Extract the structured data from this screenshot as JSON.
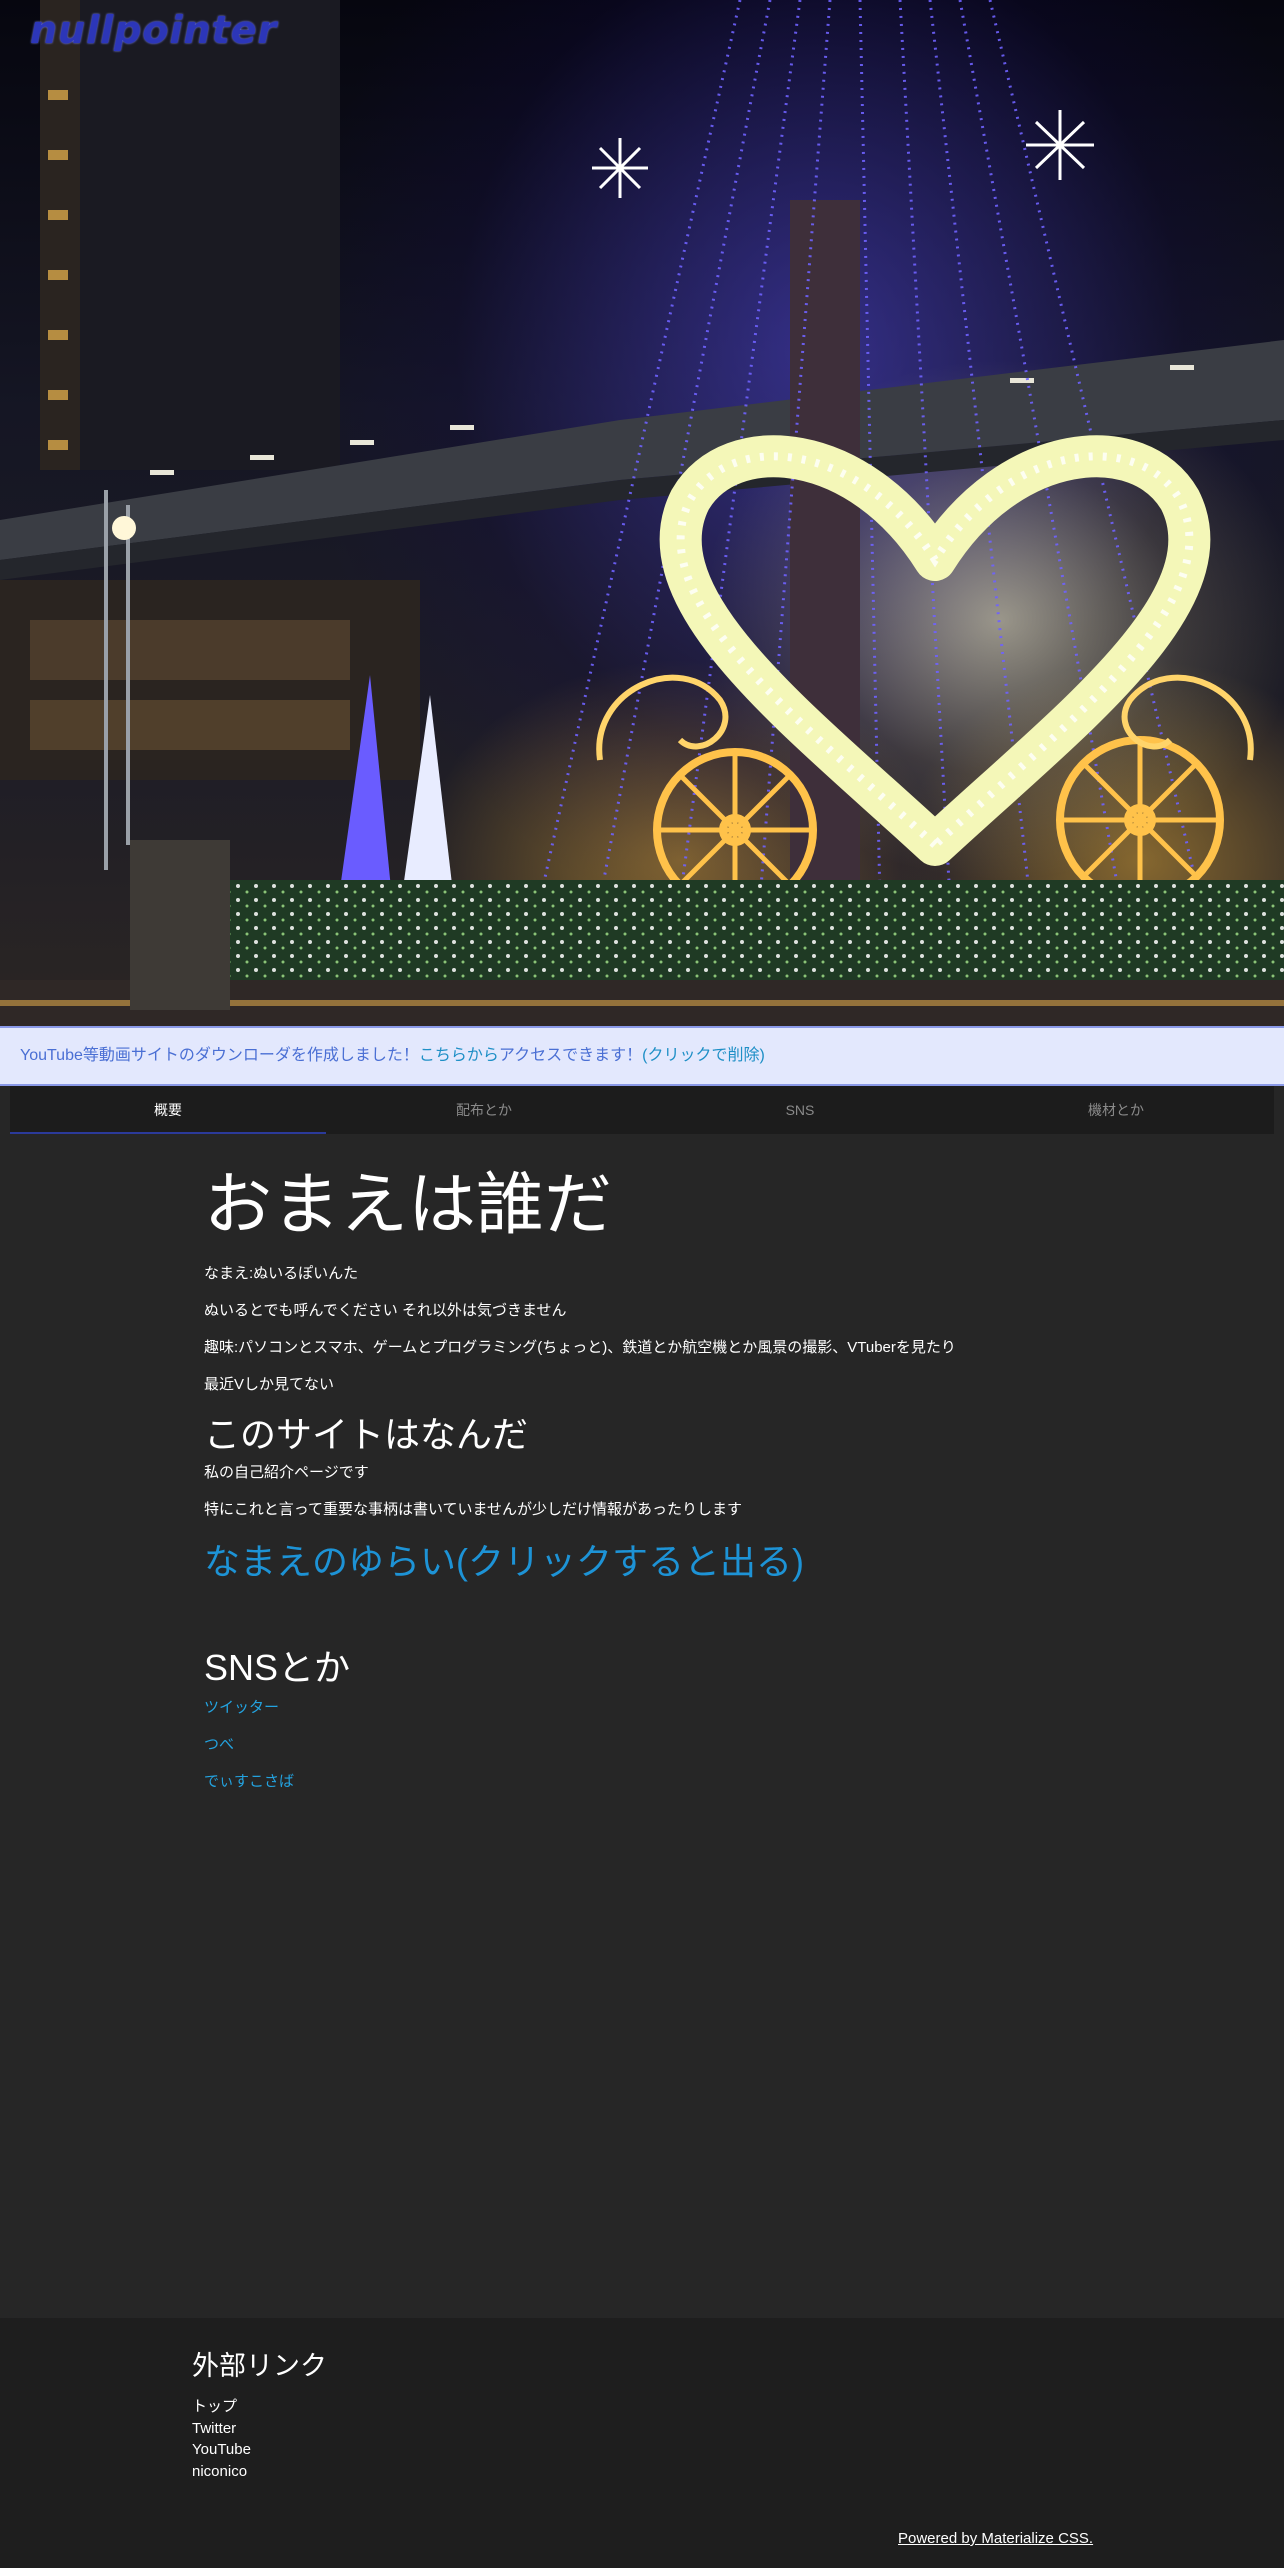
{
  "header": {
    "logo_text": "nullpointer"
  },
  "banner": {
    "text_before": "YouTube等動画サイトのダウンローダを作成しました！",
    "link_text": "こちらから",
    "text_after": "アクセスできます！",
    "dismiss_text": "(クリックで削除)"
  },
  "tabs": [
    {
      "label": "概要",
      "active": true
    },
    {
      "label": "配布とか",
      "active": false
    },
    {
      "label": "SNS",
      "active": false
    },
    {
      "label": "機材とか",
      "active": false
    }
  ],
  "about": {
    "title": "おまえは誰だ",
    "lines": [
      "なまえ:ぬいるぽいんた",
      "ぬいるとでも呼んでください それ以外は気づきません",
      "趣味:パソコンとスマホ、ゲームとプログラミング(ちょっと)、鉄道とか航空機とか風景の撮影、VTuberを見たり",
      "最近Vしか見てない"
    ]
  },
  "site": {
    "title": "このサイトはなんだ",
    "lines": [
      "私の自己紹介ページです",
      "特にこれと言って重要な事柄は書いていませんが少しだけ情報があったりします"
    ],
    "origin_link": "なまえのゆらい(クリックすると出る)"
  },
  "sns": {
    "title": "SNSとか",
    "links": [
      "ツイッター",
      "つべ",
      "でぃすこさば"
    ]
  },
  "footer": {
    "title": "外部リンク",
    "links": [
      "トップ",
      "Twitter",
      "YouTube",
      "niconico"
    ],
    "powered": "Powered by Materialize CSS."
  },
  "colors": {
    "background": "#262626",
    "banner_bg": "#e3e8fd",
    "link": "#23a3e0",
    "tab_bar": "#1c1c1c",
    "footer_bg": "#1e1e1e"
  }
}
